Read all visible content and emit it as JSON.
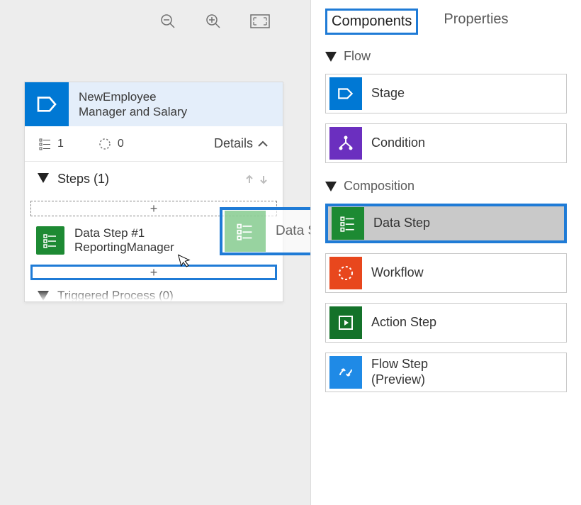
{
  "tabs": {
    "components": "Components",
    "properties": "Properties"
  },
  "sections": {
    "flow": "Flow",
    "composition": "Composition"
  },
  "components": {
    "stage": "Stage",
    "condition": "Condition",
    "data_step": "Data Step",
    "workflow": "Workflow",
    "action_step": "Action Step",
    "flow_step": "Flow Step\n(Preview)"
  },
  "stage": {
    "title": "NewEmployee",
    "subtitle": "Manager and Salary",
    "stats": {
      "fields": "1",
      "workflows": "0"
    },
    "details": "Details",
    "steps_header": "Steps (1)",
    "triggered": "Triggered Process (0)"
  },
  "step": {
    "name": "Data Step #1",
    "sub": "ReportingManager"
  },
  "drop_plus": "+",
  "drag_ghost_label": "Data Step"
}
